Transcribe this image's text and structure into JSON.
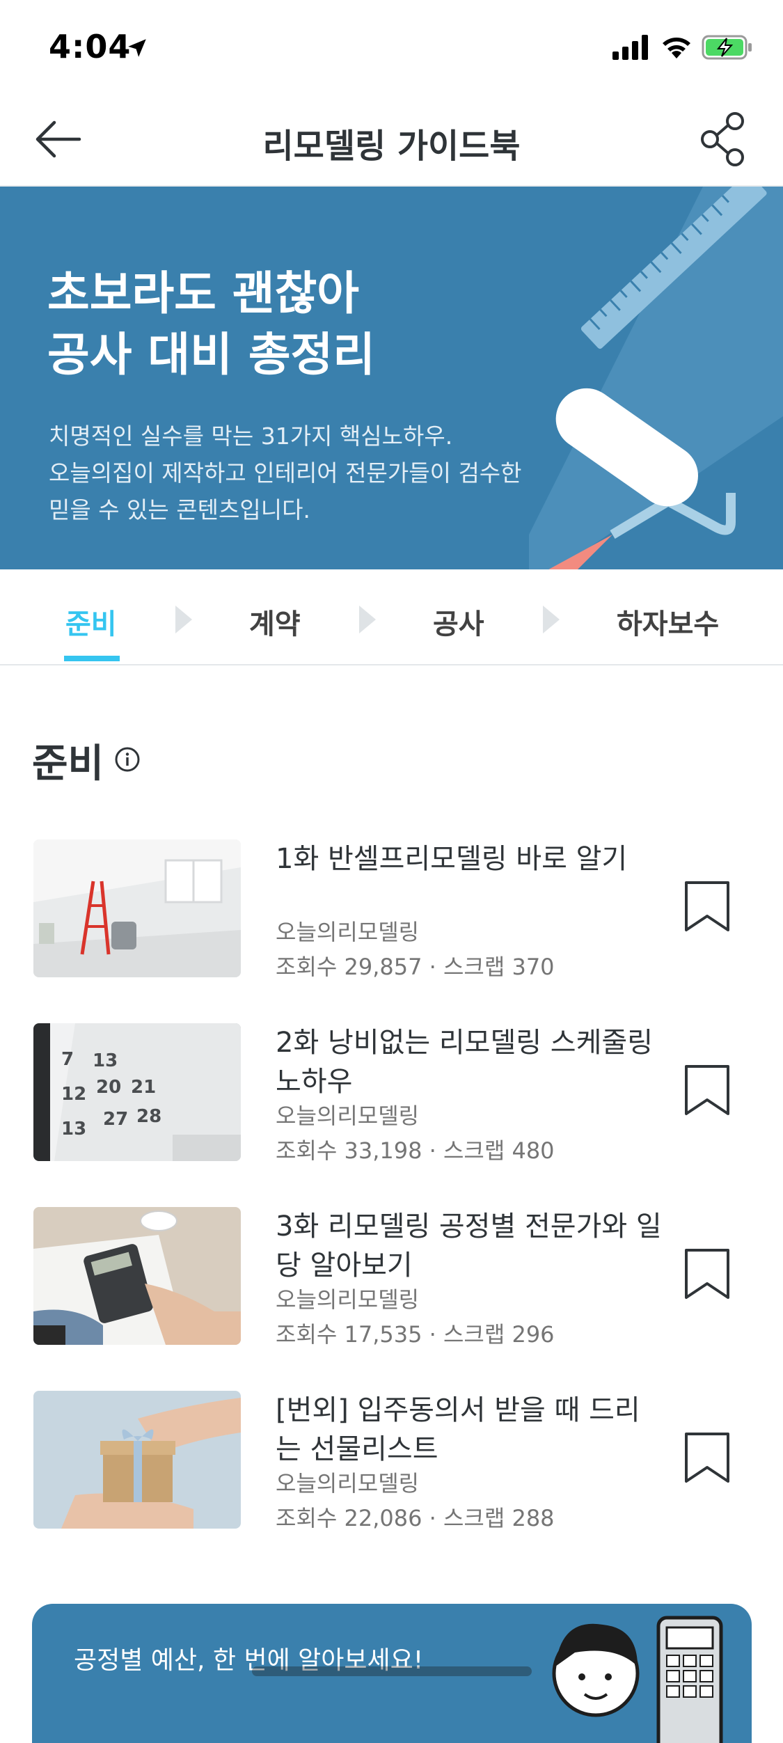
{
  "status_bar": {
    "time": "4:04"
  },
  "nav": {
    "title": "리모델링 가이드북"
  },
  "banner": {
    "title_line1": "초보라도 괜찮아",
    "title_line2": "공사 대비 총정리",
    "desc_line1": "치명적인 실수를 막는 31가지 핵심노하우.",
    "desc_line2": "오늘의집이 제작하고 인테리어 전문가들이 검수한",
    "desc_line3": "믿을 수 있는 콘텐츠입니다.",
    "bg_color": "#3a80ad"
  },
  "tabs": [
    {
      "label": "준비",
      "active": true
    },
    {
      "label": "계약",
      "active": false
    },
    {
      "label": "공사",
      "active": false
    },
    {
      "label": "하자보수",
      "active": false
    }
  ],
  "accent_color": "#35c5f0",
  "section": {
    "title": "준비"
  },
  "items": [
    {
      "title": "1화 반셀프리모델링 바로 알기",
      "author": "오늘의리모델링",
      "stats": "조회수 29,857 · 스크랩 370"
    },
    {
      "title": "2화 낭비없는 리모델링 스케줄링 노하우",
      "author": "오늘의리모델링",
      "stats": "조회수 33,198 · 스크랩 480"
    },
    {
      "title": "3화 리모델링 공정별 전문가와 일당 알아보기",
      "author": "오늘의리모델링",
      "stats": "조회수 17,535 · 스크랩 296"
    },
    {
      "title": "[번외] 입주동의서 받을 때 드리는 선물리스트",
      "author": "오늘의리모델링",
      "stats": "조회수 22,086 · 스크랩 288"
    }
  ],
  "cta": {
    "text": "공정별 예산, 한 번에 알아보세요!"
  }
}
